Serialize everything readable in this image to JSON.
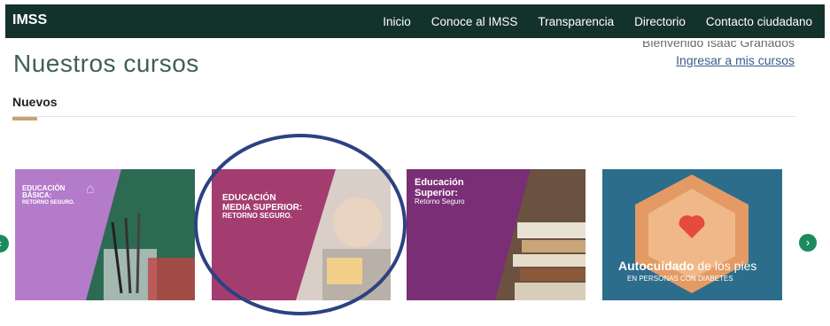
{
  "header": {
    "brand": "IMSS",
    "nav": [
      "Inicio",
      "Conoce al IMSS",
      "Transparencia",
      "Directorio",
      "Contacto ciudadano"
    ]
  },
  "user": {
    "welcome": "Bienvenido Isaac Granados",
    "login_link": "Ingresar a mis cursos"
  },
  "page": {
    "title": "Nuestros cursos",
    "section": "Nuevos"
  },
  "cards": [
    {
      "line1": "EDUCACIÓN",
      "line2": "BÁSICA:",
      "line3": "RETORNO SEGURO."
    },
    {
      "line1": "EDUCACIÓN",
      "line2": "MEDIA SUPERIOR:",
      "line3": "RETORNO SEGURO."
    },
    {
      "line1": "Educación",
      "line2": "Superior:",
      "line3": "Retorno Seguro"
    },
    {
      "title_bold": "Autocuidado",
      "title_rest": " de los pies",
      "subtitle": "EN PERSONAS CON DIABETES"
    }
  ],
  "colors": {
    "header_bg": "#13322b",
    "accent_gold": "#c5a46d",
    "title_green": "#3f6053",
    "highlight_circle": "#2c4281"
  },
  "icons": {
    "prev": "chevron-left-icon",
    "next": "chevron-right-icon"
  }
}
